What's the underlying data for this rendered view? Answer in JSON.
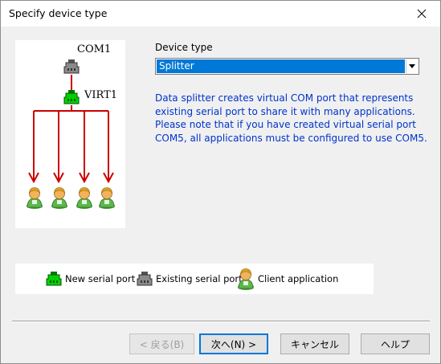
{
  "window": {
    "title": "Specify device type"
  },
  "diagram": {
    "com_port_label": "COM1",
    "virtual_port_label": "VIRT1",
    "client_count": 4
  },
  "device_type": {
    "label": "Device type",
    "selected": "Splitter"
  },
  "description": {
    "line1": "Data splitter creates virtual COM port that represents",
    "line2": "existing serial port to share it with many applications.",
    "line3": "Please note that if you have created virtual serial port",
    "line4": "COM5, all applications must be configured to use COM5."
  },
  "legend": {
    "new_port": "New serial port",
    "existing_port": "Existing serial port",
    "client_app": "Client application"
  },
  "buttons": {
    "back": "< 戻る(B)",
    "next": "次へ(N) >",
    "cancel": "キャンセル",
    "help": "ヘルプ"
  },
  "colors": {
    "new_port": "#00cc00",
    "existing_port": "#808080",
    "arrow": "#cc0000",
    "selection": "#0078d7",
    "description_text": "#0033cc",
    "focus_border": "#0078d7"
  },
  "icons": {
    "close": "close-icon",
    "dropdown": "chevron-down-icon",
    "new_port": "new-serial-port-icon",
    "existing_port": "existing-serial-port-icon",
    "client": "client-application-icon"
  }
}
